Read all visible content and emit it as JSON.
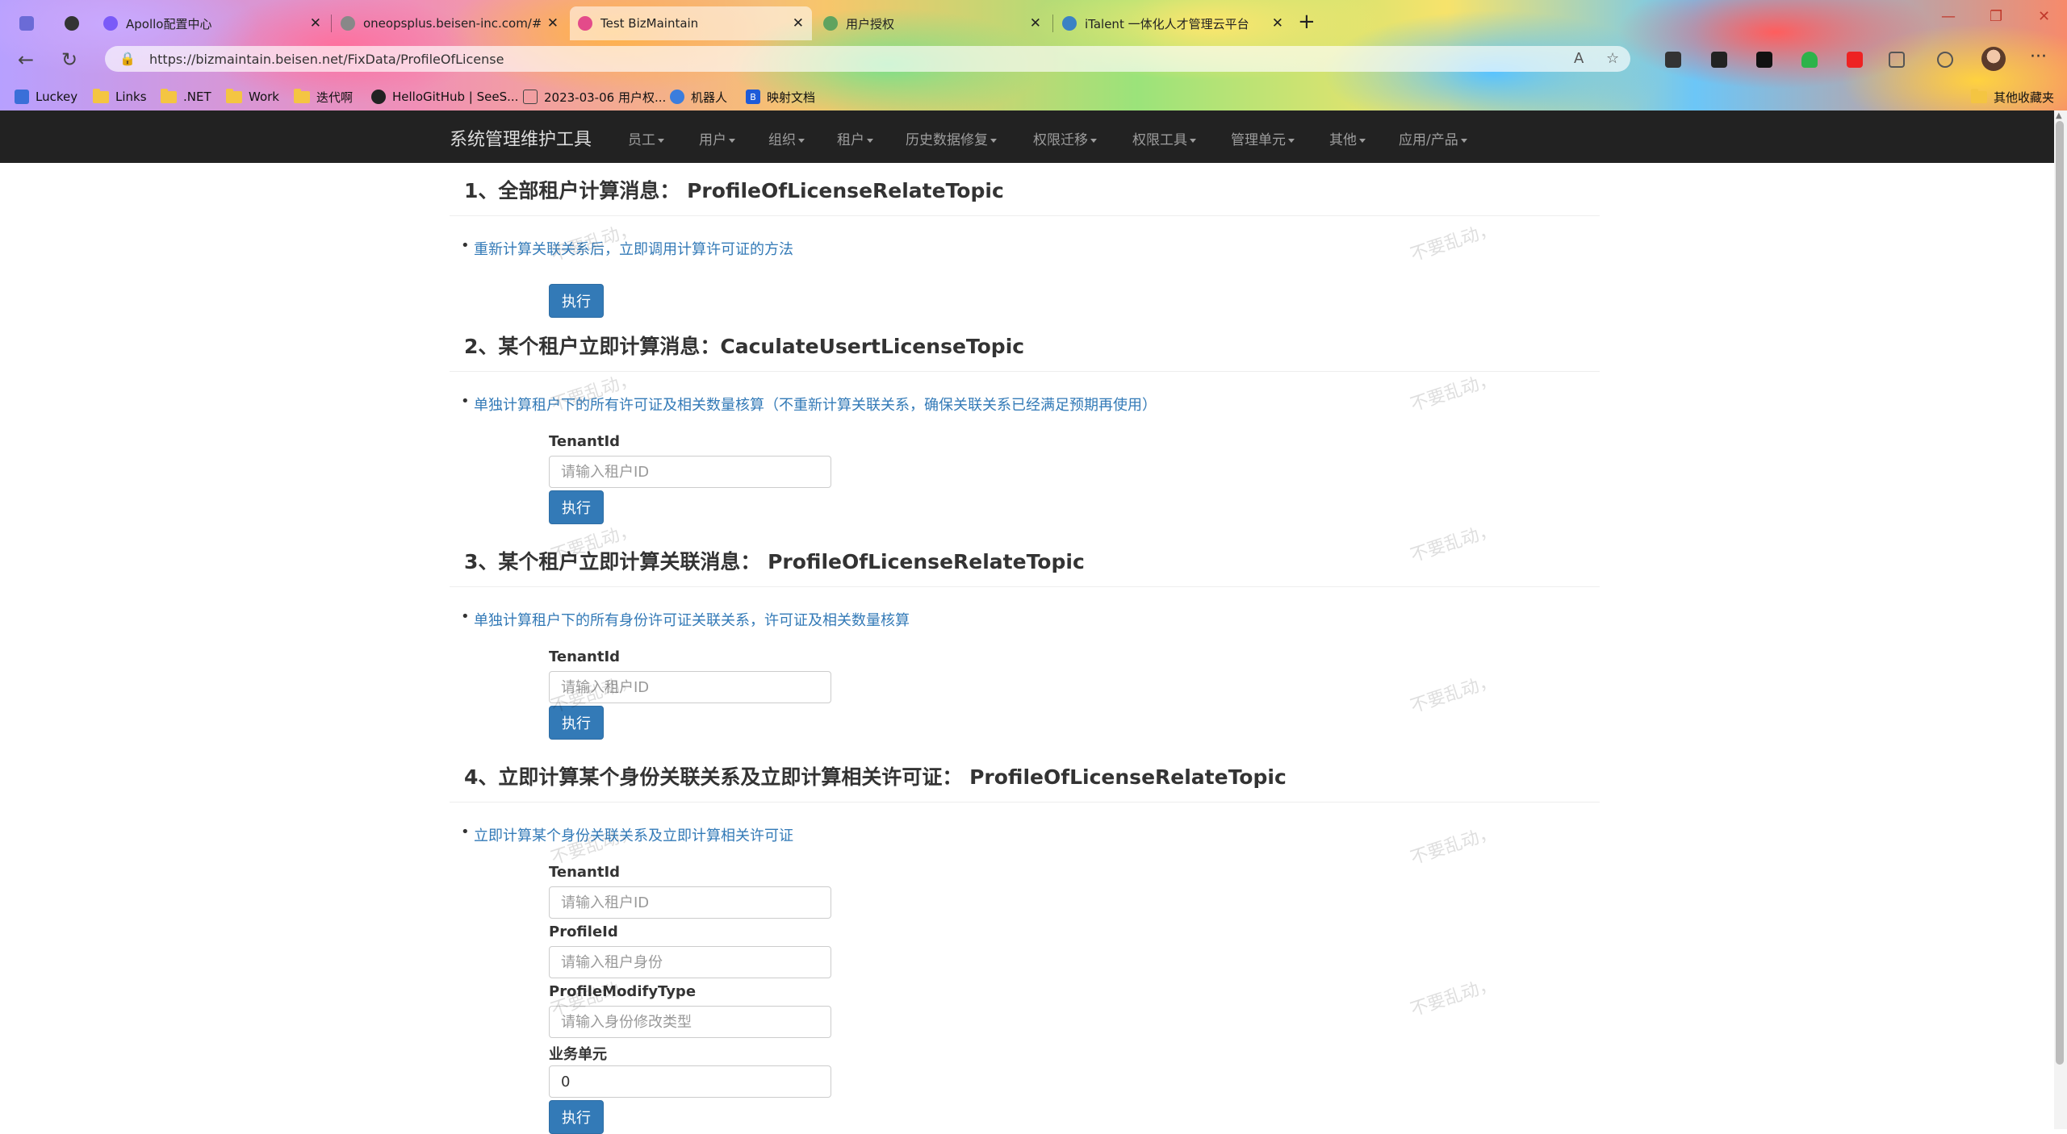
{
  "browser": {
    "tabs": [
      {
        "title": "",
        "color": "#6b6bd6"
      },
      {
        "title": "",
        "color": "#333333"
      },
      {
        "title": "Apollo配置中心",
        "color": "#7a5af8"
      },
      {
        "title": "oneopsplus.beisen-inc.com/#/",
        "color": "#888888"
      },
      {
        "title": "Test BizMaintain",
        "color": "#e34b8a"
      },
      {
        "title": "用户授权",
        "color": "#5fa35f"
      },
      {
        "title": "iTalent 一体化人才管理云平台",
        "color": "#3b82c4"
      }
    ],
    "url": "https://bizmaintain.beisen.net/FixData/ProfileOfLicense",
    "bookmarks": [
      {
        "label": "Luckey",
        "icon": "csdn-icon"
      },
      {
        "label": "Links",
        "icon": "folder-icon"
      },
      {
        "label": ".NET",
        "icon": "folder-icon"
      },
      {
        "label": "Work",
        "icon": "folder-icon"
      },
      {
        "label": "迭代啊",
        "icon": "folder-icon"
      },
      {
        "label": "HelloGitHub | SeeS...",
        "icon": "hellogithub-icon"
      },
      {
        "label": "2023-03-06 用户权...",
        "icon": "doc-icon"
      },
      {
        "label": "机器人",
        "icon": "bot-icon"
      },
      {
        "label": "映射文档",
        "icon": "bold-b-icon"
      }
    ],
    "other_bookmarks": "其他收藏夹"
  },
  "navbar": {
    "brand": "系统管理维护工具",
    "items": [
      "员工",
      "用户",
      "组织",
      "租户",
      "历史数据修复",
      "权限迁移",
      "权限工具",
      "管理单元",
      "其他",
      "应用/产品"
    ]
  },
  "sections": [
    {
      "title": "1、全部租户计算消息： ProfileOfLicenseRelateTopic",
      "desc": "重新计算关联关系后，立即调用计算许可证的方法",
      "button": "执行"
    },
    {
      "title": "2、某个租户立即计算消息：CaculateUsertLicenseTopic",
      "desc": "单独计算租户下的所有许可证及相关数量核算（不重新计算关联关系，确保关联关系已经满足预期再使用）",
      "label": "TenantId",
      "placeholder": "请输入租户ID",
      "button": "执行"
    },
    {
      "title": "3、某个租户立即计算关联消息： ProfileOfLicenseRelateTopic",
      "desc": "单独计算租户下的所有身份许可证关联关系，许可证及相关数量核算",
      "label": "TenantId",
      "placeholder": "请输入租户ID",
      "button": "执行"
    },
    {
      "title": "4、立即计算某个身份关联关系及立即计算相关许可证： ProfileOfLicenseRelateTopic",
      "desc": "立即计算某个身份关联关系及立即计算相关许可证",
      "fields": [
        {
          "label": "TenantId",
          "placeholder": "请输入租户ID",
          "value": ""
        },
        {
          "label": "ProfileId",
          "placeholder": "请输入租户身份",
          "value": ""
        },
        {
          "label": "ProfileModifyType",
          "placeholder": "请输入身份修改类型",
          "value": ""
        },
        {
          "label": "业务单元",
          "placeholder": "",
          "value": "0"
        }
      ],
      "button": "执行"
    }
  ],
  "watermark": "不要乱动，",
  "colors": {
    "navbar": "#222222",
    "link": "#337ab7",
    "button": "#337ab7"
  }
}
